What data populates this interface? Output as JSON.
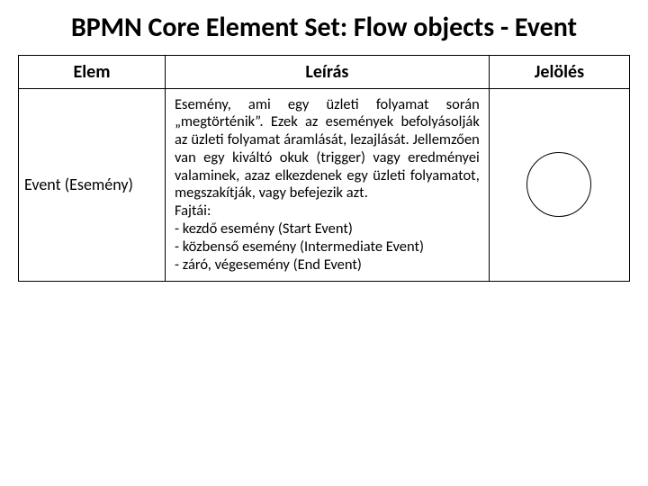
{
  "title": "BPMN Core Element Set: Flow objects - Event",
  "headers": {
    "elem": "Elem",
    "desc": "Leírás",
    "sym": "Jelölés"
  },
  "row": {
    "elem": "Event (Esemény)",
    "desc_p1": "Esemény, ami egy üzleti folyamat során „megtörténik”. Ezek az események befolyásolják az üzleti folyamat áramlását, lezajlását. Jellemzően van egy kiváltó okuk (trigger) vagy eredményei valaminek, azaz elkezdenek egy üzleti folyamatot, megszakítják, vagy befejezik azt.",
    "desc_p2": "Fajtái:",
    "desc_p3": "- kezdő esemény (Start Event)",
    "desc_p4": "- közbenső esemény (Intermediate Event)",
    "desc_p5": "- záró, végesemény (End Event)"
  }
}
